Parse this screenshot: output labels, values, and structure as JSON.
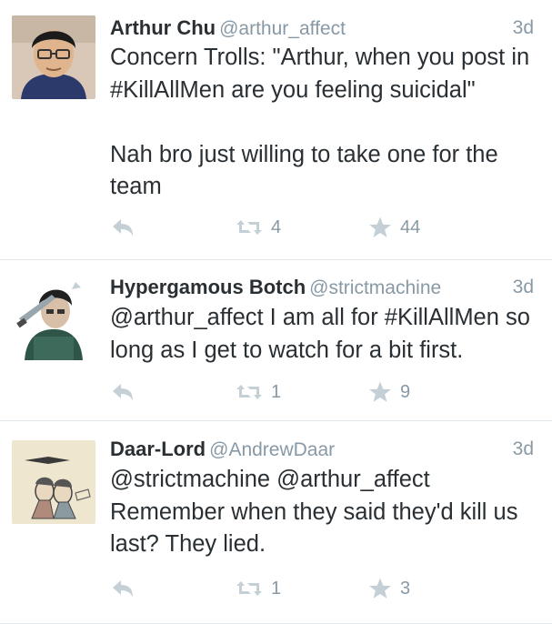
{
  "tweets": [
    {
      "name": "Arthur Chu",
      "handle": "@arthur_affect",
      "time": "3d",
      "text": "Concern Trolls: \"Arthur, when you post in #KillAllMen are you feeling suicidal\"\n\nNah bro just willing to take one for the team",
      "retweets": "4",
      "favorites": "44"
    },
    {
      "name": "Hypergamous Botch",
      "handle": "@strictmachine",
      "time": "3d",
      "text": "@arthur_affect I am all for #KillAllMen so long as I get to watch for a bit first.",
      "retweets": "1",
      "favorites": "9"
    },
    {
      "name": "Daar-Lord",
      "handle": "@AndrewDaar",
      "time": "3d",
      "text": "@strictmachine @arthur_affect Remember when they said they'd kill us last? They lied.",
      "retweets": "1",
      "favorites": "3"
    }
  ],
  "colors": {
    "text": "#292f33",
    "muted": "#8899a6",
    "icon": "#c4cfd6",
    "divider": "#e1e8ed"
  },
  "icons": {
    "reply": "reply-icon",
    "retweet": "retweet-icon",
    "favorite": "star-icon"
  }
}
